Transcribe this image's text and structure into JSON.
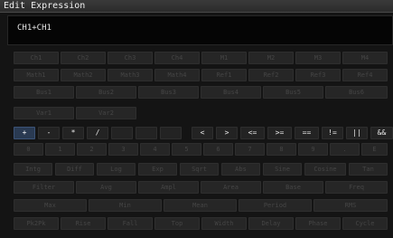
{
  "window": {
    "title": "Edit Expression"
  },
  "expression": {
    "value": "CH1+CH1"
  },
  "rows": {
    "row1": [
      "Ch1",
      "Ch2",
      "Ch3",
      "Ch4",
      "M1",
      "M2",
      "M3",
      "M4"
    ],
    "row2": [
      "Math1",
      "Math2",
      "Math3",
      "Math4",
      "Ref1",
      "Ref2",
      "Ref3",
      "Ref4"
    ],
    "row3": [
      "Bus1",
      "Bus2",
      "Bus3",
      "Bus4",
      "Bus5",
      "Bus6"
    ],
    "row4": [
      "Var1",
      "Var2"
    ],
    "row5": [
      "+",
      "-",
      "*",
      "/",
      "(",
      ")",
      "<",
      ">",
      "<=",
      ">=",
      "==",
      "!=",
      "||",
      "&&"
    ],
    "row6": [
      "0",
      "1",
      "2",
      "3",
      "4",
      "5",
      "6",
      "7",
      "8",
      "9",
      ".",
      "E"
    ],
    "row7": [
      "Intg",
      "Diff",
      "Log",
      "Exp",
      "Sqrt",
      "Abs",
      "Sine",
      "Cosine",
      "Tan"
    ],
    "row8": [
      "Filter",
      "Avg",
      "Ampl",
      "Area",
      "Base",
      "Freq"
    ],
    "row9": [
      "Max",
      "Min",
      "Mean",
      "Period",
      "RMS"
    ],
    "row10": [
      "Pk2Pk",
      "Rise",
      "Fall",
      "Top",
      "Width",
      "Delay",
      "Phase",
      "Cycle"
    ]
  }
}
